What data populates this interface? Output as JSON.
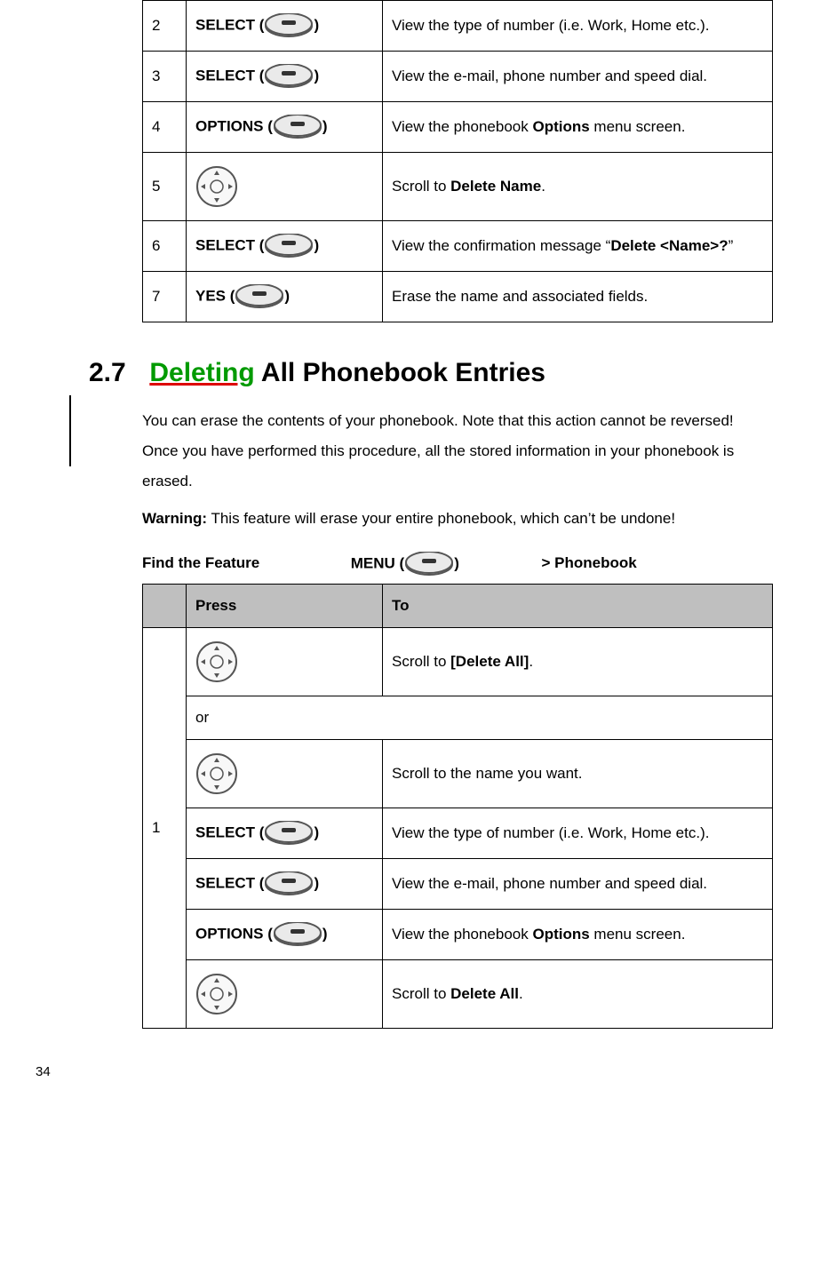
{
  "table1": {
    "rows": [
      {
        "num": "2",
        "press_label": "SELECT",
        "press_icon": "softkey",
        "to_pre": "View the type of number (i.e. Work, Home etc.).",
        "to_bold": "",
        "to_post": ""
      },
      {
        "num": "3",
        "press_label": "SELECT",
        "press_icon": "softkey",
        "to_pre": "View the e-mail, phone number and speed dial.",
        "to_bold": "",
        "to_post": ""
      },
      {
        "num": "4",
        "press_label": "OPTIONS",
        "press_icon": "softkey",
        "to_pre": "View the phonebook ",
        "to_bold": "Options",
        "to_post": " menu screen."
      },
      {
        "num": "5",
        "press_label": "",
        "press_icon": "nav",
        "to_pre": "Scroll to ",
        "to_bold": "Delete Name",
        "to_post": "."
      },
      {
        "num": "6",
        "press_label": "SELECT",
        "press_icon": "softkey",
        "to_pre": "View the confirmation message “",
        "to_bold": "Delete <Name>?",
        "to_post": "”"
      },
      {
        "num": "7",
        "press_label": "YES",
        "press_icon": "softkey",
        "to_pre": "Erase the name and associated fields.",
        "to_bold": "",
        "to_post": ""
      }
    ]
  },
  "section": {
    "number": "2.7",
    "title_deleting": "Deleting",
    "title_rest": " All Phonebook Entries"
  },
  "body_text": "You can erase the contents of your phonebook. Note that this action cannot be reversed! Once you have performed this procedure, all the stored information in your phonebook is erased.",
  "warning_label": "Warning:",
  "warning_text": "  This feature will erase your entire phonebook, which can’t be undone!",
  "find_feature": {
    "label": "Find the Feature",
    "menu_label": "MENU",
    "breadcrumb": "> Phonebook"
  },
  "table2": {
    "head_press": "Press",
    "head_to": "To",
    "group_num": "1",
    "rows": [
      {
        "type": "row",
        "press_label": "",
        "press_icon": "nav",
        "to_pre": "Scroll to ",
        "to_bold": "[Delete All]",
        "to_post": "."
      },
      {
        "type": "or",
        "text": "or"
      },
      {
        "type": "row",
        "press_label": "",
        "press_icon": "nav",
        "to_pre": "Scroll to the name you want.",
        "to_bold": "",
        "to_post": ""
      },
      {
        "type": "row",
        "press_label": "SELECT",
        "press_icon": "softkey",
        "to_pre": "View the type of number (i.e. Work, Home etc.).",
        "to_bold": "",
        "to_post": ""
      },
      {
        "type": "row",
        "press_label": "SELECT",
        "press_icon": "softkey",
        "to_pre": "View the e-mail, phone number and speed dial.",
        "to_bold": "",
        "to_post": ""
      },
      {
        "type": "row",
        "press_label": "OPTIONS",
        "press_icon": "softkey",
        "to_pre": "View the phonebook ",
        "to_bold": "Options",
        "to_post": " menu screen."
      },
      {
        "type": "row",
        "press_label": "",
        "press_icon": "nav",
        "to_pre": "Scroll to ",
        "to_bold": "Delete All",
        "to_post": "."
      }
    ]
  },
  "page_number": "34"
}
